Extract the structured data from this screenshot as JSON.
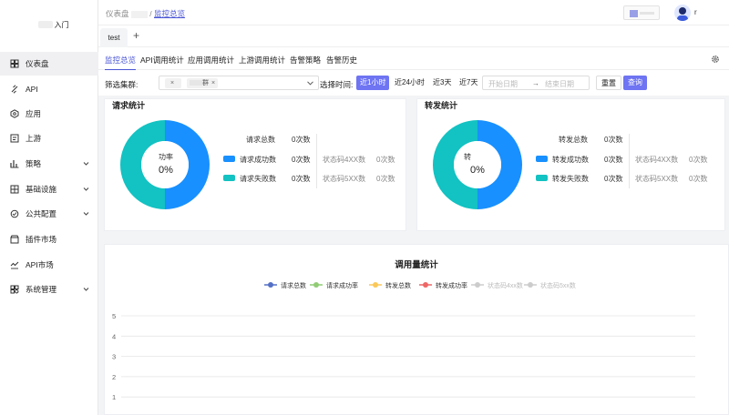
{
  "sidebar": {
    "logo_text": "入门",
    "items": [
      {
        "label": "仪表盘",
        "icon": "dashboard-icon",
        "active": true,
        "chevron": false
      },
      {
        "label": "API",
        "icon": "link-icon",
        "active": false,
        "chevron": false
      },
      {
        "label": "应用",
        "icon": "app-icon",
        "active": false,
        "chevron": false
      },
      {
        "label": "上游",
        "icon": "upstream-icon",
        "active": false,
        "chevron": false
      },
      {
        "label": "策略",
        "icon": "strategy-icon",
        "active": false,
        "chevron": true
      },
      {
        "label": "基础设施",
        "icon": "infrastructure-icon",
        "active": false,
        "chevron": true
      },
      {
        "label": "公共配置",
        "icon": "config-icon",
        "active": false,
        "chevron": true
      },
      {
        "label": "插件市场",
        "icon": "plugin-market-icon",
        "active": false,
        "chevron": false
      },
      {
        "label": "API市场",
        "icon": "api-market-icon",
        "active": false,
        "chevron": false
      },
      {
        "label": "系统管理",
        "icon": "system-icon",
        "active": false,
        "chevron": true
      }
    ]
  },
  "header": {
    "breadcrumb_root": "仪表盘",
    "breadcrumb_sep": "/",
    "breadcrumb_current": "监控总览",
    "user_name": "r"
  },
  "tabs": {
    "open_tab": "test",
    "add_symbol": "+"
  },
  "subnav": {
    "tabs": [
      "监控总览",
      "API调用统计",
      "应用调用统计",
      "上游调用统计",
      "告警策略",
      "告警历史"
    ]
  },
  "filter": {
    "cluster_label": "筛选集群:",
    "chip_1": "",
    "chip_2": "群",
    "chip_close": "×",
    "time_label": "选择时间:",
    "time_options": [
      "近1小时",
      "近24小时",
      "近3天",
      "近7天"
    ],
    "start_placeholder": "开始日期",
    "arrow": "→",
    "end_placeholder": "结束日期",
    "reset_label": "重置",
    "query_label": "查询"
  },
  "request_card": {
    "title": "请求统计",
    "donut_label": "功率",
    "donut_value": "0%",
    "total_label": "请求总数",
    "total_value": "0次数",
    "success_label": "请求成功数",
    "success_value": "0次数",
    "fail_label": "请求失败数",
    "fail_value": "0次数",
    "code4_label": "状态码4XX数",
    "code4_value": "0次数",
    "code5_label": "状态码5XX数",
    "code5_value": "0次数",
    "success_color": "#1890ff",
    "fail_color": "#13c2c2"
  },
  "forward_card": {
    "title": "转发统计",
    "donut_label": "转",
    "donut_value": "0%",
    "total_label": "转发总数",
    "total_value": "0次数",
    "success_label": "转发成功数",
    "success_value": "0次数",
    "fail_label": "转发失败数",
    "fail_value": "0次数",
    "code4_label": "状态码4XX数",
    "code4_value": "0次数",
    "code5_label": "状态码5XX数",
    "code5_value": "0次数",
    "success_color": "#1890ff",
    "fail_color": "#13c2c2"
  },
  "chart_data": {
    "type": "line",
    "title": "调用量统计",
    "legend_position": "top-center",
    "series": [
      {
        "name": "请求总数",
        "color": "#5470c6",
        "enabled": true,
        "values": []
      },
      {
        "name": "请求成功率",
        "color": "#91cc75",
        "enabled": true,
        "values": []
      },
      {
        "name": "转发总数",
        "color": "#fac858",
        "enabled": true,
        "values": []
      },
      {
        "name": "转发成功率",
        "color": "#ee6666",
        "enabled": true,
        "values": []
      },
      {
        "name": "状态码4xx数",
        "color": "#cccccc",
        "enabled": false,
        "values": []
      },
      {
        "name": "状态码5xx数",
        "color": "#cccccc",
        "enabled": false,
        "values": []
      }
    ],
    "y_ticks": [
      "5",
      "4",
      "3",
      "2",
      "1"
    ],
    "ylim": [
      0,
      5
    ],
    "grid": true
  }
}
